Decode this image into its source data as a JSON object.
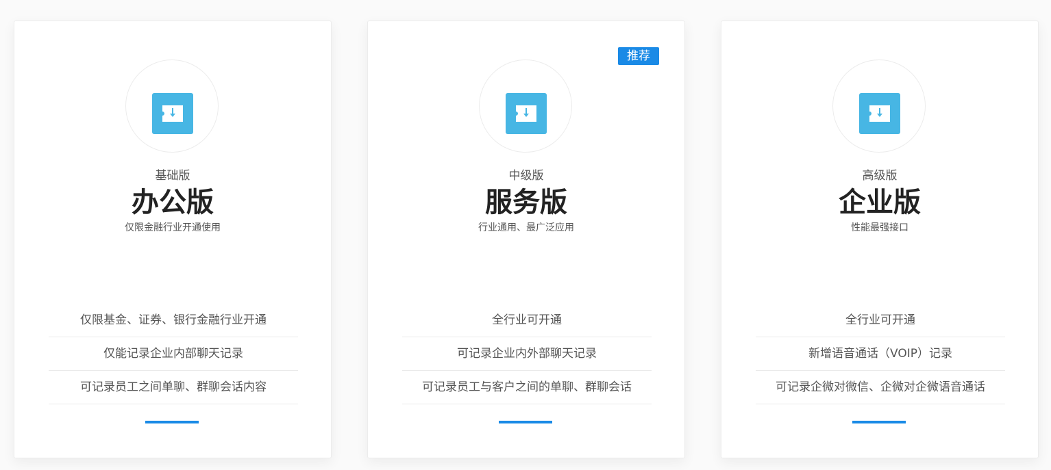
{
  "colors": {
    "accent": "#1a8ae6",
    "icon_bg": "#47b6e4"
  },
  "plans": [
    {
      "tier": "基础版",
      "name": "办公版",
      "subtitle": "仅限金融行业开通使用",
      "badge": "",
      "icon": "box-arrow-down-icon",
      "features": [
        "仅限基金、证券、银行金融行业开通",
        "仅能记录企业内部聊天记录",
        "可记录员工之间单聊、群聊会话内容"
      ]
    },
    {
      "tier": "中级版",
      "name": "服务版",
      "subtitle": "行业通用、最广泛应用",
      "badge": "推荐",
      "icon": "box-arrow-down-icon",
      "features": [
        "全行业可开通",
        "可记录企业内外部聊天记录",
        "可记录员工与客户之间的单聊、群聊会话"
      ]
    },
    {
      "tier": "高级版",
      "name": "企业版",
      "subtitle": "性能最强接口",
      "badge": "",
      "icon": "box-arrow-down-icon",
      "features": [
        "全行业可开通",
        "新增语音通话（VOIP）记录",
        "可记录企微对微信、企微对企微语音通话"
      ]
    }
  ]
}
